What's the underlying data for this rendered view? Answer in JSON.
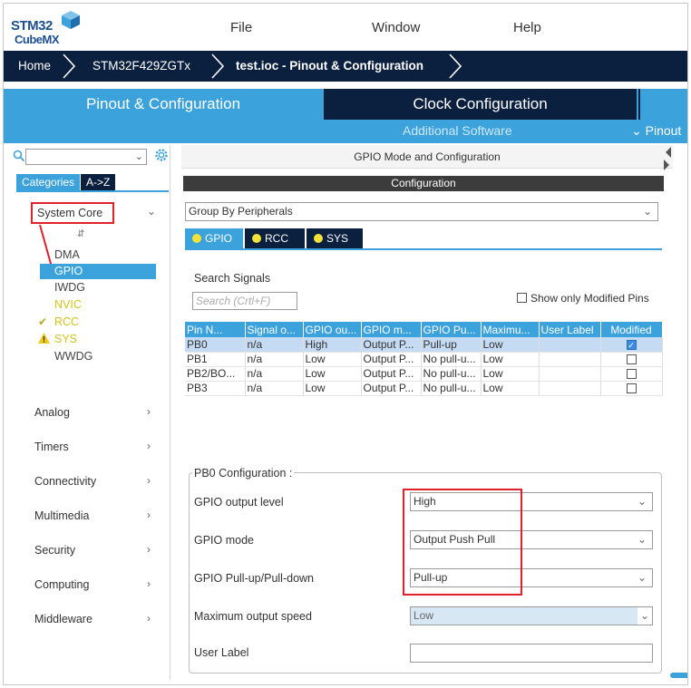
{
  "app": {
    "logo_line1": "STM32",
    "logo_line2": "CubeMX",
    "menu": [
      "File",
      "Window",
      "Help"
    ]
  },
  "breadcrumb": [
    "Home",
    "STM32F429ZGTx",
    "test.ioc - Pinout & Configuration"
  ],
  "main_tabs": {
    "pinout": "Pinout & Configuration",
    "clock": "Clock Configuration",
    "additional": "Additional Software",
    "pinout_view": "⌄ Pinout"
  },
  "left": {
    "search_value": "",
    "cat_tabs": [
      "Categories",
      "A->Z"
    ],
    "system_core": "System Core",
    "system_core_items": [
      {
        "label": "DMA",
        "state": "normal"
      },
      {
        "label": "GPIO",
        "state": "selected"
      },
      {
        "label": "IWDG",
        "state": "normal"
      },
      {
        "label": "NVIC",
        "state": "yellow"
      },
      {
        "label": "RCC",
        "state": "check"
      },
      {
        "label": "SYS",
        "state": "warn"
      },
      {
        "label": "WWDG",
        "state": "normal"
      }
    ],
    "sections": [
      "Analog",
      "Timers",
      "Connectivity",
      "Multimedia",
      "Security",
      "Computing",
      "Middleware"
    ]
  },
  "right": {
    "header": "GPIO Mode and Configuration",
    "config_bar": "Configuration",
    "group_by": "Group By Peripherals",
    "peripheral_tabs": [
      "GPIO",
      "RCC",
      "SYS"
    ],
    "search_signals_label": "Search Signals",
    "search_placeholder": "Search (Crtl+F)",
    "only_modified": "Show only Modified Pins",
    "table": {
      "headers": [
        "Pin N...",
        "Signal o...",
        "GPIO ou...",
        "GPIO m...",
        "GPIO Pu...",
        "Maximu...",
        "User Label",
        "Modified"
      ],
      "rows": [
        {
          "pin": "PB0",
          "signal": "n/a",
          "output": "High",
          "mode": "Output P...",
          "pull": "Pull-up",
          "speed": "Low",
          "label": "",
          "modified": true
        },
        {
          "pin": "PB1",
          "signal": "n/a",
          "output": "Low",
          "mode": "Output P...",
          "pull": "No pull-u...",
          "speed": "Low",
          "label": "",
          "modified": false
        },
        {
          "pin": "PB2/BO...",
          "signal": "n/a",
          "output": "Low",
          "mode": "Output P...",
          "pull": "No pull-u...",
          "speed": "Low",
          "label": "",
          "modified": false
        },
        {
          "pin": "PB3",
          "signal": "n/a",
          "output": "Low",
          "mode": "Output P...",
          "pull": "No pull-u...",
          "speed": "Low",
          "label": "",
          "modified": false
        }
      ]
    },
    "pb0_config": {
      "legend": "PB0 Configuration :",
      "output_level_label": "GPIO output level",
      "output_level_value": "High",
      "mode_label": "GPIO mode",
      "mode_value": "Output Push Pull",
      "pull_label": "GPIO Pull-up/Pull-down",
      "pull_value": "Pull-up",
      "speed_label": "Maximum output speed",
      "speed_value": "Low",
      "user_label_label": "User Label",
      "user_label_value": ""
    }
  },
  "colors": {
    "accent_blue": "#3ca2dc",
    "navy": "#0b1f3f",
    "highlight_red": "#e0202a"
  }
}
